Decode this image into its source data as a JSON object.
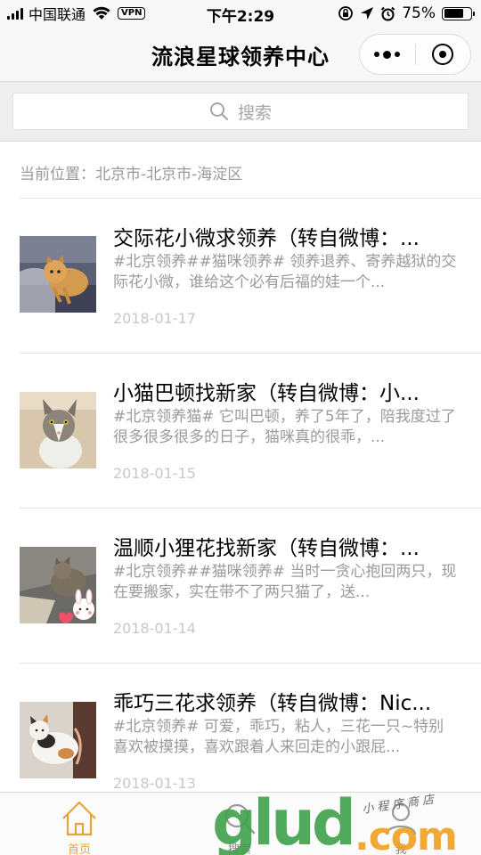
{
  "status_bar": {
    "carrier": "中国联通",
    "vpn": "VPN",
    "time": "下午2:29",
    "battery_pct": "75%",
    "battery_level": 0.75
  },
  "nav": {
    "title": "流浪星球领养中心",
    "more_icon": "more-dots-icon",
    "close_icon": "target-circle-icon"
  },
  "search": {
    "placeholder": "搜索"
  },
  "location": {
    "text": "当前位置：北京市-北京市-海淀区"
  },
  "posts": [
    {
      "title": "交际花小微求领养（转自微博：...",
      "desc": "#北京领养##猫咪领养# 领养退养、寄养越狱的交际花小微，谁给这个必有后福的娃一个...",
      "date": "2018-01-17",
      "thumb": "orange-tabby-cat"
    },
    {
      "title": "小猫巴顿找新家（转自微博：小...",
      "desc": "#北京领养猫# 它叫巴顿，养了5年了，陪我度过了很多很多很多的日子，猫咪真的很乖，...",
      "date": "2018-01-15",
      "thumb": "grey-white-cat"
    },
    {
      "title": "温顺小狸花找新家（转自微博：...",
      "desc": "#北京领养##猫咪领养# 当时一贪心抱回两只，现在要搬家，实在带不了两只猫了，送...",
      "date": "2018-01-14",
      "thumb": "tabby-kitten-with-stickers"
    },
    {
      "title": "乖巧三花求领养（转自微博：Nic...",
      "desc": "#北京领养# 可爱，乖巧，粘人，三花一只~特别喜欢被摸摸，喜欢跟着人来回走的小跟屁...",
      "date": "2018-01-13",
      "thumb": "calico-cat"
    }
  ],
  "tabs": [
    {
      "label": "首页",
      "icon": "home-icon",
      "active": true
    },
    {
      "label": "搜索",
      "icon": "search-icon",
      "active": false
    },
    {
      "label": "我",
      "icon": "user-icon",
      "active": false
    }
  ],
  "watermark": {
    "brand": "glud",
    "domain": ".com",
    "tagline": "小程序商店"
  },
  "colors": {
    "accent": "#e8a33b",
    "nav_bg": "#f8f8f8",
    "search_bg": "#eeeeee",
    "muted_text": "#9a9a9a",
    "date_text": "#c8c8c8"
  }
}
